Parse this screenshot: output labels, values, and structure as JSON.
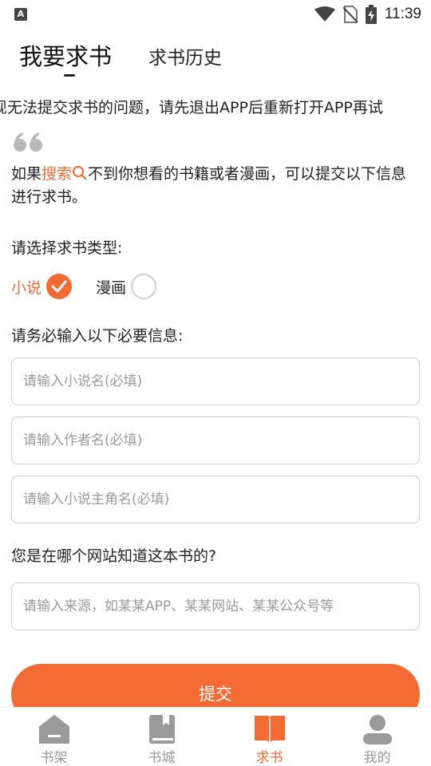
{
  "status_bar": {
    "app_icon_letter": "A",
    "time": "11:39"
  },
  "tabs": {
    "active": "我要求书",
    "inactive": "求书历史"
  },
  "notice": "现无法提交求书的问题，请先退出APP后重新打开APP再试",
  "intro": {
    "prefix": "如果",
    "search_link": "搜索",
    "suffix": "不到你想看的书籍或者漫画，可以提交以下信息进行求书。"
  },
  "type_section": {
    "label": "请选择求书类型:",
    "options": [
      {
        "label": "小说",
        "selected": true
      },
      {
        "label": "漫画",
        "selected": false
      }
    ]
  },
  "required_section": {
    "label": "请务必输入以下必要信息:",
    "fields": [
      {
        "placeholder": "请输入小说名(必填)",
        "value": ""
      },
      {
        "placeholder": "请输入作者名(必填)",
        "value": ""
      },
      {
        "placeholder": "请输入小说主角名(必填)",
        "value": ""
      }
    ]
  },
  "source_section": {
    "label": "您是在哪个网站知道这本书的?",
    "field": {
      "placeholder": "请输入来源，如某某APP、某某网站、某某公众号等",
      "value": ""
    }
  },
  "submit_label": "提交",
  "bottom_nav": [
    {
      "label": "书架",
      "icon": "home-icon",
      "active": false
    },
    {
      "label": "书城",
      "icon": "book-icon",
      "active": false
    },
    {
      "label": "求书",
      "icon": "open-book-icon",
      "active": true
    },
    {
      "label": "我的",
      "icon": "user-icon",
      "active": false
    }
  ],
  "colors": {
    "accent": "#f26b34",
    "inactive": "#9a9a9a",
    "border": "#cfcfcf"
  }
}
